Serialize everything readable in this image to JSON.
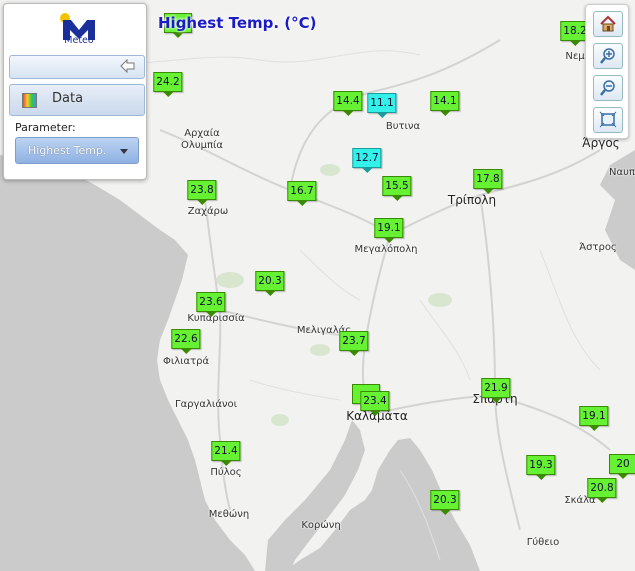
{
  "map": {
    "title": "Highest Temp. (°C)",
    "colors": {
      "sea": "#cbcbcb",
      "land": "#f2f2f1",
      "road": "#d8d8d8",
      "park": "#d8e6cf",
      "warm_marker": "#66f233",
      "cool_marker": "#33f0e8",
      "title": "#1b1bc8"
    },
    "places": [
      {
        "name": "Αρχαία Ολυμπία",
        "line1": "Αρχαία",
        "line2": "Ολυμπία"
      },
      {
        "name": "Βυτινα"
      },
      {
        "name": "Τρίπολη"
      },
      {
        "name": "Άργος"
      },
      {
        "name": "Ναυπ"
      },
      {
        "name": "Νεμ"
      },
      {
        "name": "Ζαχάρω"
      },
      {
        "name": "Μεγαλόπολη"
      },
      {
        "name": "Άστρος"
      },
      {
        "name": "Κυπαρισσία"
      },
      {
        "name": "Μελιγαλάς"
      },
      {
        "name": "Φιλιατρά"
      },
      {
        "name": "Γαργαλιάνοι"
      },
      {
        "name": "Καλαμάτα"
      },
      {
        "name": "Σπάρτη"
      },
      {
        "name": "Πύλος"
      },
      {
        "name": "Σκάλα"
      },
      {
        "name": "Μεθώνη"
      },
      {
        "name": "Κορώνη"
      },
      {
        "name": "Γύθειο"
      }
    ],
    "stations": [
      {
        "temp": "24.2",
        "level": "warm"
      },
      {
        "temp": "18.2",
        "level": "warm"
      },
      {
        "temp": "14.4",
        "level": "warm"
      },
      {
        "temp": "11.1",
        "level": "cool"
      },
      {
        "temp": "14.1",
        "level": "warm"
      },
      {
        "temp": "12.7",
        "level": "cool"
      },
      {
        "temp": "15.5",
        "level": "warm"
      },
      {
        "temp": "17.8",
        "level": "warm"
      },
      {
        "temp": "23.8",
        "level": "warm"
      },
      {
        "temp": "16.7",
        "level": "warm"
      },
      {
        "temp": "19.1",
        "level": "warm"
      },
      {
        "temp": "20.3",
        "level": "warm"
      },
      {
        "temp": "23.6",
        "level": "warm"
      },
      {
        "temp": "22.6",
        "level": "warm"
      },
      {
        "temp": "23.7",
        "level": "warm"
      },
      {
        "temp": "23.4",
        "level": "warm"
      },
      {
        "temp": "21.9",
        "level": "warm"
      },
      {
        "temp": "19.1",
        "level": "warm"
      },
      {
        "temp": "21.4",
        "level": "warm"
      },
      {
        "temp": "19.3",
        "level": "warm"
      },
      {
        "temp": "20.8",
        "level": "warm"
      },
      {
        "temp": "20.3",
        "level": "warm"
      },
      {
        "temp": "20",
        "level": "warm"
      }
    ]
  },
  "panel": {
    "logo_text": "Meteo",
    "data_tab_label": "Data",
    "parameter_label": "Parameter:",
    "parameter_value": "Highest Temp."
  },
  "controls": {
    "icons": [
      "home-icon",
      "zoom-in-icon",
      "zoom-out-icon",
      "fullscreen-icon"
    ]
  }
}
